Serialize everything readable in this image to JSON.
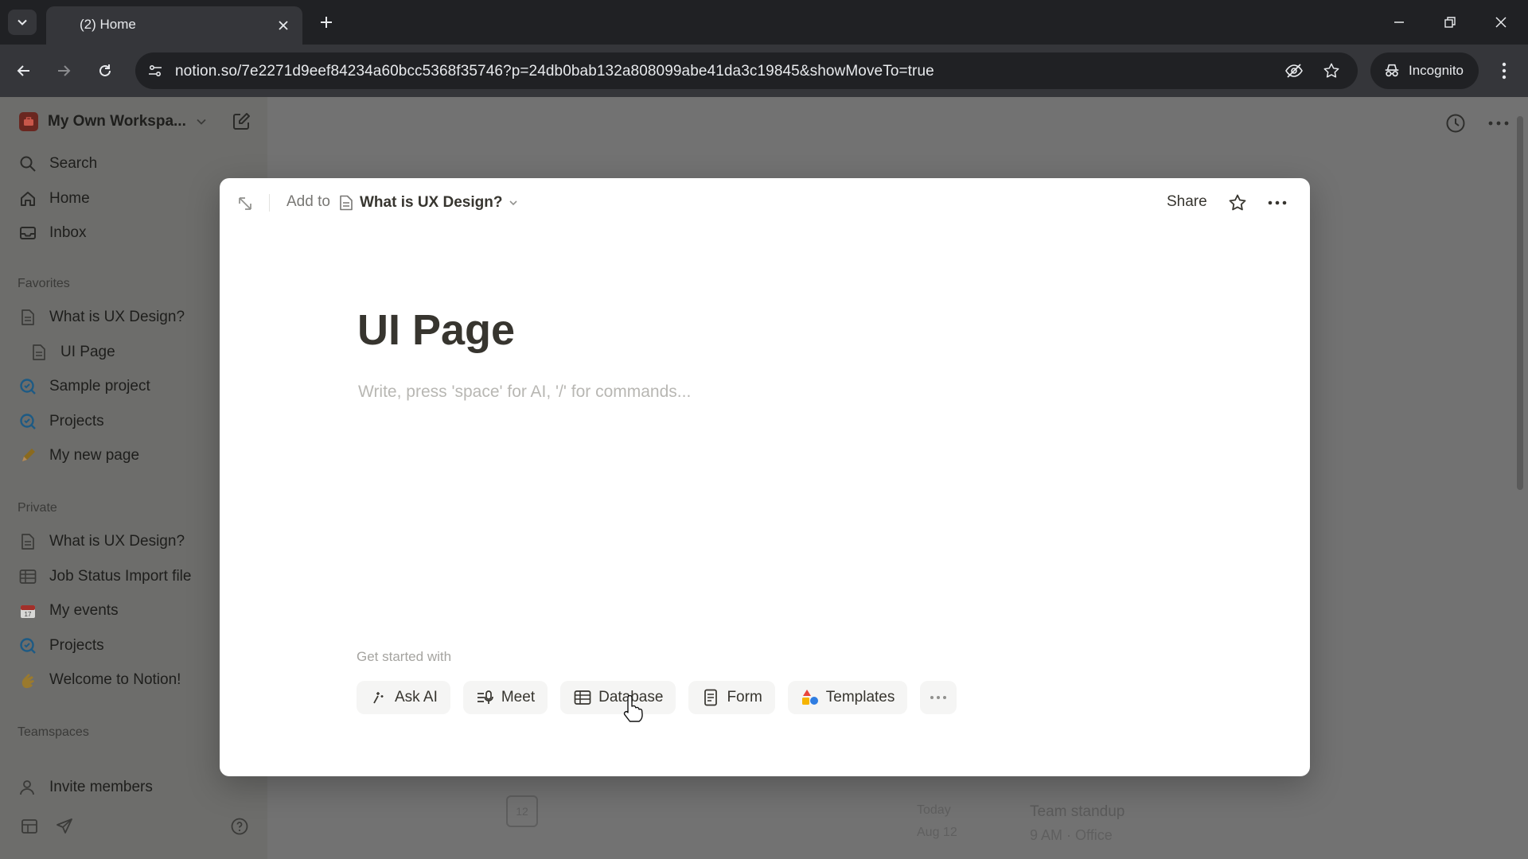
{
  "browser": {
    "tab_title": "(2) Home",
    "url": "notion.so/7e2271d9eef84234a60bcc5368f35746?p=24db0bab132a808099abe41da3c19845&showMoveTo=true",
    "incognito_label": "Incognito"
  },
  "sidebar": {
    "workspace_name": "My Own Workspa...",
    "nav": [
      {
        "label": "Search",
        "icon": "search-icon"
      },
      {
        "label": "Home",
        "icon": "home-icon"
      },
      {
        "label": "Inbox",
        "icon": "inbox-icon"
      }
    ],
    "favorites_heading": "Favorites",
    "favorites": [
      {
        "label": "What is UX Design?",
        "icon": "page-icon"
      },
      {
        "label": "UI Page",
        "icon": "page-icon"
      },
      {
        "label": "Sample project",
        "icon": "project-icon"
      },
      {
        "label": "Projects",
        "icon": "project-icon"
      },
      {
        "label": "My new page",
        "icon": "pencil-icon"
      }
    ],
    "private_heading": "Private",
    "private": [
      {
        "label": "What is UX Design?",
        "icon": "page-icon"
      },
      {
        "label": "Job Status Import file",
        "icon": "table-icon"
      },
      {
        "label": "My events",
        "icon": "calendar-icon"
      },
      {
        "label": "Projects",
        "icon": "project-icon"
      },
      {
        "label": "Welcome to Notion!",
        "icon": "wave-icon"
      }
    ],
    "teamspaces_heading": "Teamspaces",
    "invite_label": "Invite members"
  },
  "background": {
    "calendar_day": "12",
    "today_label": "Today",
    "date_label": "Aug 12",
    "event_title": "Team standup",
    "event_detail": "9 AM · Office"
  },
  "modal": {
    "add_to_label": "Add to",
    "parent_page": "What is UX Design?",
    "share_label": "Share",
    "page_title": "UI Page",
    "placeholder": "Write, press 'space' for AI, '/' for commands...",
    "get_started_label": "Get started with",
    "chips": [
      {
        "label": "Ask AI",
        "icon": "ai-icon"
      },
      {
        "label": "Meet",
        "icon": "meet-icon"
      },
      {
        "label": "Database",
        "icon": "table-icon"
      },
      {
        "label": "Form",
        "icon": "form-icon"
      },
      {
        "label": "Templates",
        "icon": "templates-icon"
      }
    ]
  }
}
